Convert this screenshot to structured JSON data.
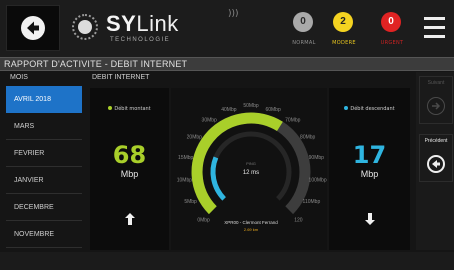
{
  "header": {
    "brand_bold": "SY",
    "brand_light": "Link",
    "brand_sub": "TECHNOLOGIE",
    "statuses": [
      {
        "count": "0",
        "label": "NORMAL",
        "color": "#a9a9a9"
      },
      {
        "count": "2",
        "label": "MODERE",
        "color": "#f4d321"
      },
      {
        "count": "0",
        "label": "URGENT",
        "color": "#e02323"
      }
    ]
  },
  "title": "RAPPORT D'ACTIVITE - DEBIT INTERNET",
  "sidebar": {
    "header": "MOIS",
    "months": [
      "AVRIL 2018",
      "MARS",
      "FEVRIER",
      "JANVIER",
      "DECEMBRE",
      "NOVEMBRE"
    ],
    "active_index": 0
  },
  "content_header": "DEBIT INTERNET",
  "upload": {
    "caption": "Débit montant",
    "value": "68",
    "unit": "Mbp",
    "color": "#a9cf2a"
  },
  "download": {
    "caption": "Débit descendant",
    "value": "17",
    "unit": "Mbp",
    "color": "#2fb5e0"
  },
  "gauge": {
    "ticks": [
      "0Mbp",
      "5Mbp",
      "10Mbp",
      "15Mbp",
      "20Mbp",
      "30Mbp",
      "40Mbp",
      "50Mbp",
      "60Mbp",
      "70Mbp",
      "80Mbp",
      "90Mbp",
      "100Mbp",
      "110Mbp",
      "120"
    ],
    "ping_label": "PING",
    "ping_value": "12 ms",
    "provider": "XPR00 - Clermont Ferrand",
    "provider_sub": "2.69 km",
    "upload_fraction": 0.62,
    "download_fraction": 0.25,
    "colors": {
      "outer": "#a9cf2a",
      "inner": "#2fb5e0",
      "track": "#3d3d3d"
    }
  },
  "nav": {
    "next_label": "Suivant",
    "prev_label": "Précédent"
  }
}
